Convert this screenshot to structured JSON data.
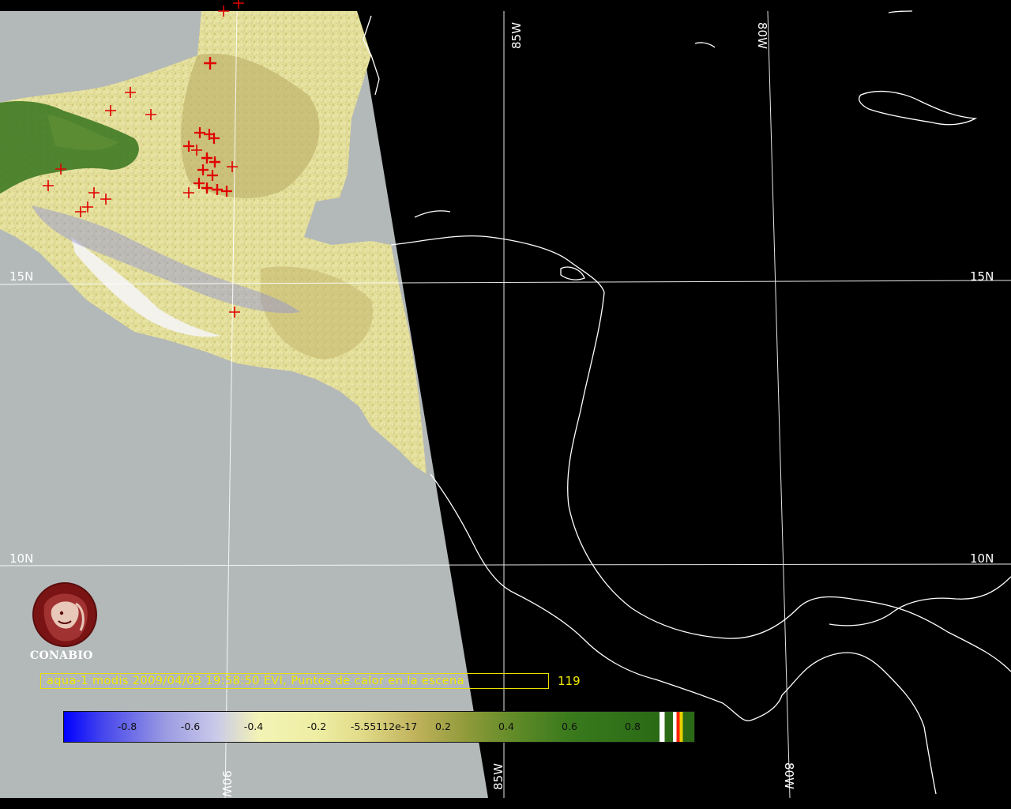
{
  "map": {
    "caption": "aqua-1 modis 2009/04/03 19:58:50 EVI, Puntos de calor en la escena",
    "hotspot_count": "119",
    "organization": "CONABIO",
    "latitude_labels": {
      "lat15": "15N",
      "lat10": "10N"
    },
    "longitude_labels": {
      "lon85": "85W",
      "lon80": "80W",
      "lon90": "90W"
    },
    "colorbar": {
      "variable": "EVI",
      "ticks": [
        "-0.8",
        "-0.6",
        "-0.4",
        "-0.2",
        "-5.55112e-17",
        "0.2",
        "0.4",
        "0.6",
        "0.8"
      ]
    },
    "colors": {
      "background": "#000000",
      "no_data_swath": "#b3b8b9",
      "hotspot": "#e00000",
      "caption": "#f2e800",
      "coastline": "#ffffff"
    },
    "hotspot_markers": "red-cross-icon"
  }
}
